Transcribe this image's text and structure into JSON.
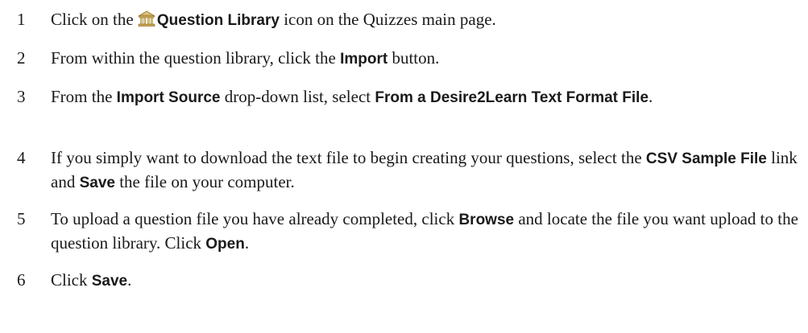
{
  "steps": [
    {
      "number": "1",
      "parts": [
        {
          "t": "Click on the ",
          "ui": false
        },
        {
          "icon": "question-library-icon"
        },
        {
          "t": "Question Library",
          "ui": true
        },
        {
          "t": " icon on the Quizzes main page.",
          "ui": false
        }
      ]
    },
    {
      "number": "2",
      "parts": [
        {
          "t": "From within the question library, click the ",
          "ui": false
        },
        {
          "t": "Import",
          "ui": true
        },
        {
          "t": " button.",
          "ui": false
        }
      ]
    },
    {
      "number": "3",
      "parts": [
        {
          "t": "From the ",
          "ui": false
        },
        {
          "t": "Import Source",
          "ui": true
        },
        {
          "t": " drop-down list, select ",
          "ui": false
        },
        {
          "t": "From a Desire2Learn Text Format File",
          "ui": true
        },
        {
          "t": ".",
          "ui": false
        }
      ]
    },
    {
      "number": "4",
      "parts": [
        {
          "t": "If you simply want to download the text file to begin creating your questions, select the ",
          "ui": false
        },
        {
          "t": "CSV Sample File",
          "ui": true
        },
        {
          "t": " link and ",
          "ui": false
        },
        {
          "t": "Save",
          "ui": true
        },
        {
          "t": " the file on your computer.",
          "ui": false
        }
      ]
    },
    {
      "number": "5",
      "parts": [
        {
          "t": "To upload a question file you have already completed, click ",
          "ui": false
        },
        {
          "t": "Browse",
          "ui": true
        },
        {
          "t": " and locate the file you want upload to the question library. Click ",
          "ui": false
        },
        {
          "t": "Open",
          "ui": true
        },
        {
          "t": ".",
          "ui": false
        }
      ]
    },
    {
      "number": "6",
      "parts": [
        {
          "t": "Click ",
          "ui": false
        },
        {
          "t": "Save",
          "ui": true
        },
        {
          "t": ".",
          "ui": false
        }
      ]
    }
  ]
}
